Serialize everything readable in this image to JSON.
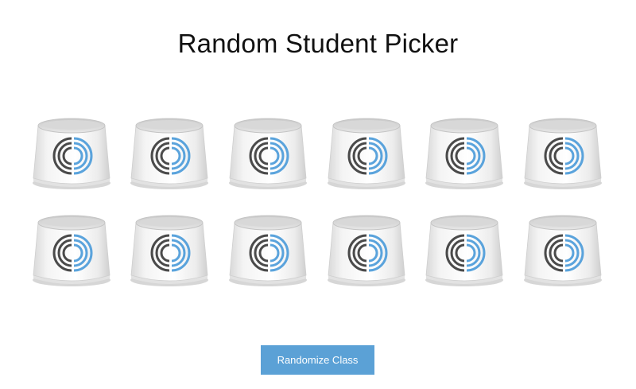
{
  "page": {
    "title": "Random Student Picker",
    "randomize_label": "Randomize Class"
  },
  "cups": {
    "count": 12,
    "logo_icon": "split-arc-logo-icon",
    "colors": {
      "logo_left": "#4a4a4a",
      "logo_right": "#5aa3dc",
      "button_bg": "#5ba1d6"
    }
  }
}
